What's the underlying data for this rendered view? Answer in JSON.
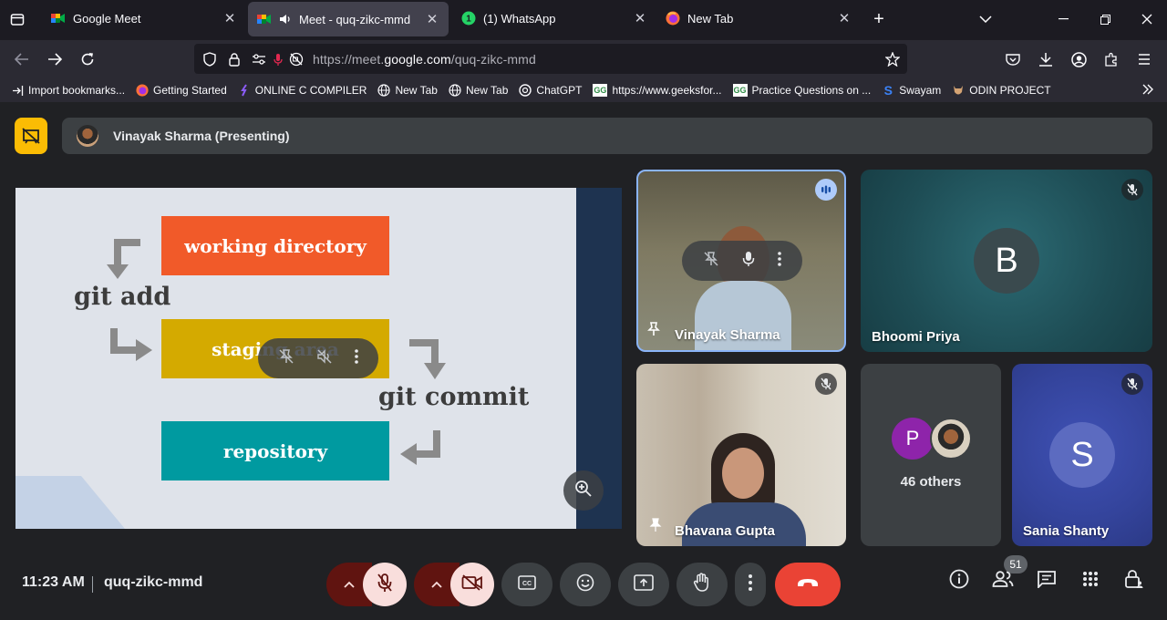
{
  "browser": {
    "tabs": [
      {
        "title": "Google Meet",
        "icon": "google-meet-icon"
      },
      {
        "title": "Meet - quq-zikc-mmd",
        "icon": "google-meet-icon",
        "active": true
      },
      {
        "title": "(1) WhatsApp",
        "icon": "whatsapp-icon",
        "badge": "1"
      },
      {
        "title": "New Tab",
        "icon": "firefox-icon"
      }
    ],
    "url_prefix": "https://meet.",
    "url_domain": "google.com",
    "url_path": "/quq-zikc-mmd",
    "bookmarks": [
      {
        "label": "Import bookmarks...",
        "icon": "import-icon"
      },
      {
        "label": "Getting Started",
        "icon": "firefox-icon"
      },
      {
        "label": "ONLINE C COMPILER",
        "icon": "compiler-icon"
      },
      {
        "label": "New Tab",
        "icon": "globe-icon"
      },
      {
        "label": "New Tab",
        "icon": "globe-icon"
      },
      {
        "label": "ChatGPT",
        "icon": "chatgpt-icon"
      },
      {
        "label": "https://www.geeksfor...",
        "icon": "gfg-icon"
      },
      {
        "label": "Practice Questions on ...",
        "icon": "gfg-icon"
      },
      {
        "label": "Swayam",
        "icon": "swayam-icon"
      },
      {
        "label": "ODIN PROJECT",
        "icon": "odin-icon"
      }
    ]
  },
  "meet": {
    "presenter_banner": "Vinayak Sharma (Presenting)",
    "slide": {
      "box1": "working directory",
      "box2": "staging area",
      "box3": "repository",
      "label_add": "git add",
      "label_commit": "git commit"
    },
    "participants": [
      {
        "name": "Vinayak Sharma",
        "speaking": true
      },
      {
        "name": "Bhoomi Priya",
        "initial": "B",
        "muted": true
      },
      {
        "name": "Bhavana Gupta",
        "muted": true
      },
      {
        "others_initial": "P",
        "others_label": "46 others"
      },
      {
        "name": "Sania Shanty",
        "initial": "S",
        "muted": true
      }
    ],
    "time": "11:23 AM",
    "meeting_code": "quq-zikc-mmd",
    "people_count": "51",
    "colors": {
      "present_yellow": "#fbbc04",
      "end_call_red": "#ea4335",
      "muted_bg": "#f9dedc",
      "muted_arrow_bg": "#601410"
    }
  }
}
